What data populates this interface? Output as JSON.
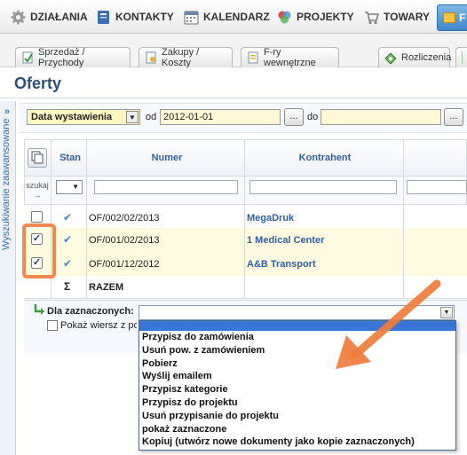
{
  "nav": {
    "items": [
      {
        "label": "DZIAŁANIA",
        "icon": "gear-icon"
      },
      {
        "label": "KONTAKTY",
        "icon": "address-book-icon"
      },
      {
        "label": "KALENDARZ",
        "icon": "calendar-icon"
      },
      {
        "label": "PROJEKTY",
        "icon": "projects-icon"
      },
      {
        "label": "TOWARY",
        "icon": "cart-icon"
      }
    ],
    "active_label": "F"
  },
  "subtabs": [
    {
      "label": "Sprzedaż / Przychody",
      "icon": "invoice-icon"
    },
    {
      "label": "Zakupy / Koszty",
      "icon": "invoice-icon"
    },
    {
      "label": "F-ry wewnętrzne",
      "icon": "invoice-icon"
    },
    {
      "label": "Rozliczenia",
      "icon": "money-icon"
    }
  ],
  "page": {
    "title": "Oferty",
    "side_label": "Wyszukiwanie zaawansowane",
    "side_chevron": "»"
  },
  "filter": {
    "date_field": "Data wystawienia",
    "from_label": "od",
    "from_value": "2012-01-01",
    "to_label": "do",
    "to_value": "",
    "picker_label": "..."
  },
  "table": {
    "headers": {
      "stan": "Stan",
      "numer": "Numer",
      "kontrahent": "Kontrahent"
    },
    "search_label": "szukaj",
    "search_arrow": "→",
    "rows": [
      {
        "checked": false,
        "status": "✔",
        "number": "OF/002/02/2013",
        "contractor": "MegaDruk"
      },
      {
        "checked": true,
        "status": "✔",
        "number": "OF/001/02/2013",
        "contractor": "1 Medical Center"
      },
      {
        "checked": true,
        "status": "✔",
        "number": "OF/001/12/2012",
        "contractor": "A&B Transport"
      }
    ],
    "sum_symbol": "Σ",
    "sum_label": "RAZEM"
  },
  "actions": {
    "label": "Dla zaznaczonych:",
    "show_row_label": "Pokaż wiersz z poc",
    "selected": "",
    "options": [
      "Przypisz do zamówienia",
      "Usuń pow. z zamówieniem",
      "Pobierz",
      "Wyślij emailem",
      "Przypisz kategorie",
      "Przypisz do projektu",
      "Usuń przypisanie do projektu",
      "pokaż zaznaczone",
      "Kopiuj (utwórz nowe dokumenty jako kopie zaznaczonych)"
    ]
  },
  "colors": {
    "accent_blue": "#2f5fa4",
    "highlight_orange": "#f07c3e",
    "row_highlight": "#fffbe0",
    "dropdown_selected": "#3875d7"
  }
}
